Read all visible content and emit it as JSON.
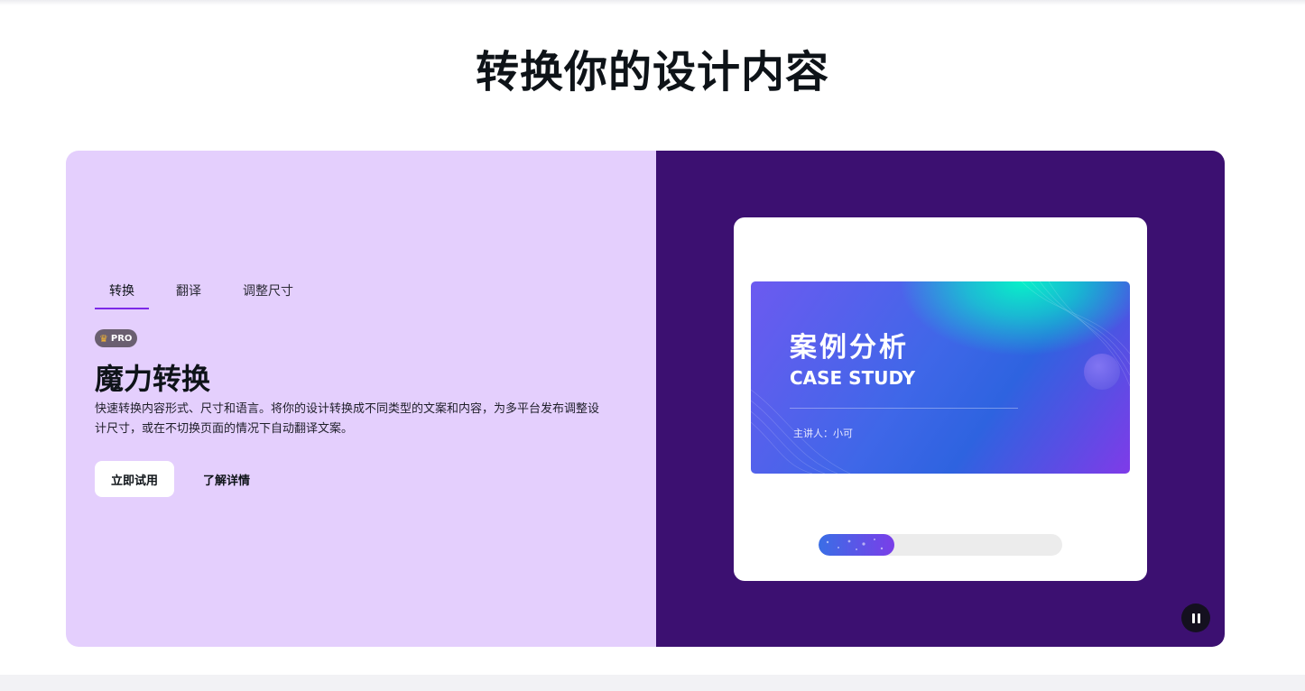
{
  "page": {
    "title": "转换你的设计内容"
  },
  "feature": {
    "tabs": [
      {
        "label": "转换",
        "active": true
      },
      {
        "label": "翻译",
        "active": false
      },
      {
        "label": "调整尺寸",
        "active": false
      }
    ],
    "badge": {
      "icon": "crown-icon",
      "label": "PRO"
    },
    "title": "魔力转换",
    "description": "快速转换内容形式、尺寸和语言。将你的设计转换成不同类型的文案和内容，为多平台发布调整设计尺寸，或在不切换页面的情况下自动翻译文案。",
    "primary_button": "立即试用",
    "secondary_button": "了解详情"
  },
  "preview": {
    "slide": {
      "title_cn": "案例分析",
      "title_en": "CASE STUDY",
      "presenter": "主讲人：小可"
    },
    "progress": 0.31,
    "control_icon": "pause-icon"
  },
  "colors": {
    "left_panel": "#e4cffd",
    "right_panel": "#3c1071",
    "accent": "#7d2ae8"
  }
}
